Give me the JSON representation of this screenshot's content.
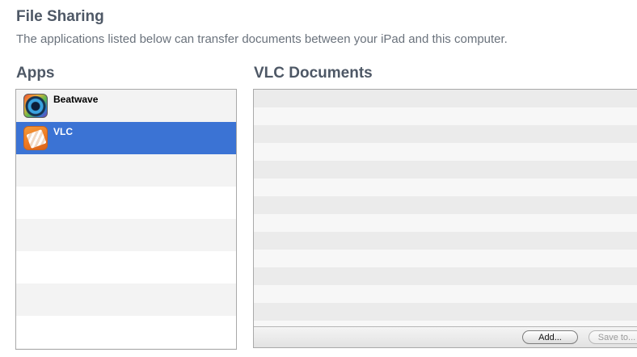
{
  "header": {
    "title": "File Sharing",
    "description": "The applications listed below can transfer documents between your iPad and this computer."
  },
  "apps": {
    "heading": "Apps",
    "items": [
      {
        "label": "Beatwave",
        "icon": "beatwave-app-icon",
        "selected": false
      },
      {
        "label": "VLC",
        "icon": "vlc-app-icon",
        "selected": true
      }
    ],
    "selection_color": "#3b73d4"
  },
  "documents": {
    "heading": "VLC Documents",
    "add_label": "Add...",
    "save_label": "Save to..."
  }
}
